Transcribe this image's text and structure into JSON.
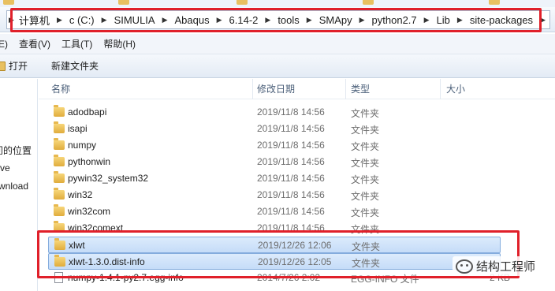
{
  "address": {
    "crumbs": [
      "计算机",
      "c (C:)",
      "SIMULIA",
      "Abaqus",
      "6.14-2",
      "tools",
      "SMApy",
      "python2.7",
      "Lib",
      "site-packages"
    ]
  },
  "menu": {
    "items": [
      "E)",
      "查看(V)",
      "工具(T)",
      "帮助(H)"
    ]
  },
  "toolbar": {
    "open_label": "打开",
    "new_folder_label": "新建文件夹"
  },
  "nav": {
    "items": [
      "问的位置",
      "ve",
      "wnload"
    ]
  },
  "columns": {
    "name": "名称",
    "date": "修改日期",
    "type": "类型",
    "size": "大小"
  },
  "files": [
    {
      "name": "adodbapi",
      "date": "2019/11/8 14:56",
      "type": "文件夹",
      "size": "",
      "kind": "folder",
      "selected": false
    },
    {
      "name": "isapi",
      "date": "2019/11/8 14:56",
      "type": "文件夹",
      "size": "",
      "kind": "folder",
      "selected": false
    },
    {
      "name": "numpy",
      "date": "2019/11/8 14:56",
      "type": "文件夹",
      "size": "",
      "kind": "folder",
      "selected": false
    },
    {
      "name": "pythonwin",
      "date": "2019/11/8 14:56",
      "type": "文件夹",
      "size": "",
      "kind": "folder",
      "selected": false
    },
    {
      "name": "pywin32_system32",
      "date": "2019/11/8 14:56",
      "type": "文件夹",
      "size": "",
      "kind": "folder",
      "selected": false
    },
    {
      "name": "win32",
      "date": "2019/11/8 14:56",
      "type": "文件夹",
      "size": "",
      "kind": "folder",
      "selected": false
    },
    {
      "name": "win32com",
      "date": "2019/11/8 14:56",
      "type": "文件夹",
      "size": "",
      "kind": "folder",
      "selected": false
    },
    {
      "name": "win32comext",
      "date": "2019/11/8 14:56",
      "type": "文件夹",
      "size": "",
      "kind": "folder",
      "selected": false
    },
    {
      "name": "xlwt",
      "date": "2019/12/26 12:06",
      "type": "文件夹",
      "size": "",
      "kind": "folder",
      "selected": true
    },
    {
      "name": "xlwt-1.3.0.dist-info",
      "date": "2019/12/26 12:05",
      "type": "文件夹",
      "size": "",
      "kind": "folder",
      "selected": true
    },
    {
      "name": "numpy-1.4.1-py2.7.egg-info",
      "date": "2014/7/26 2:02",
      "type": "EGG-INFO 文件",
      "size": "2 KB",
      "kind": "file",
      "selected": false
    }
  ],
  "watermark": {
    "text": "结构工程师"
  },
  "colors": {
    "highlight_border": "#e0202a",
    "selection_fill": "#cfe2fa",
    "folder": "#e8c060"
  }
}
